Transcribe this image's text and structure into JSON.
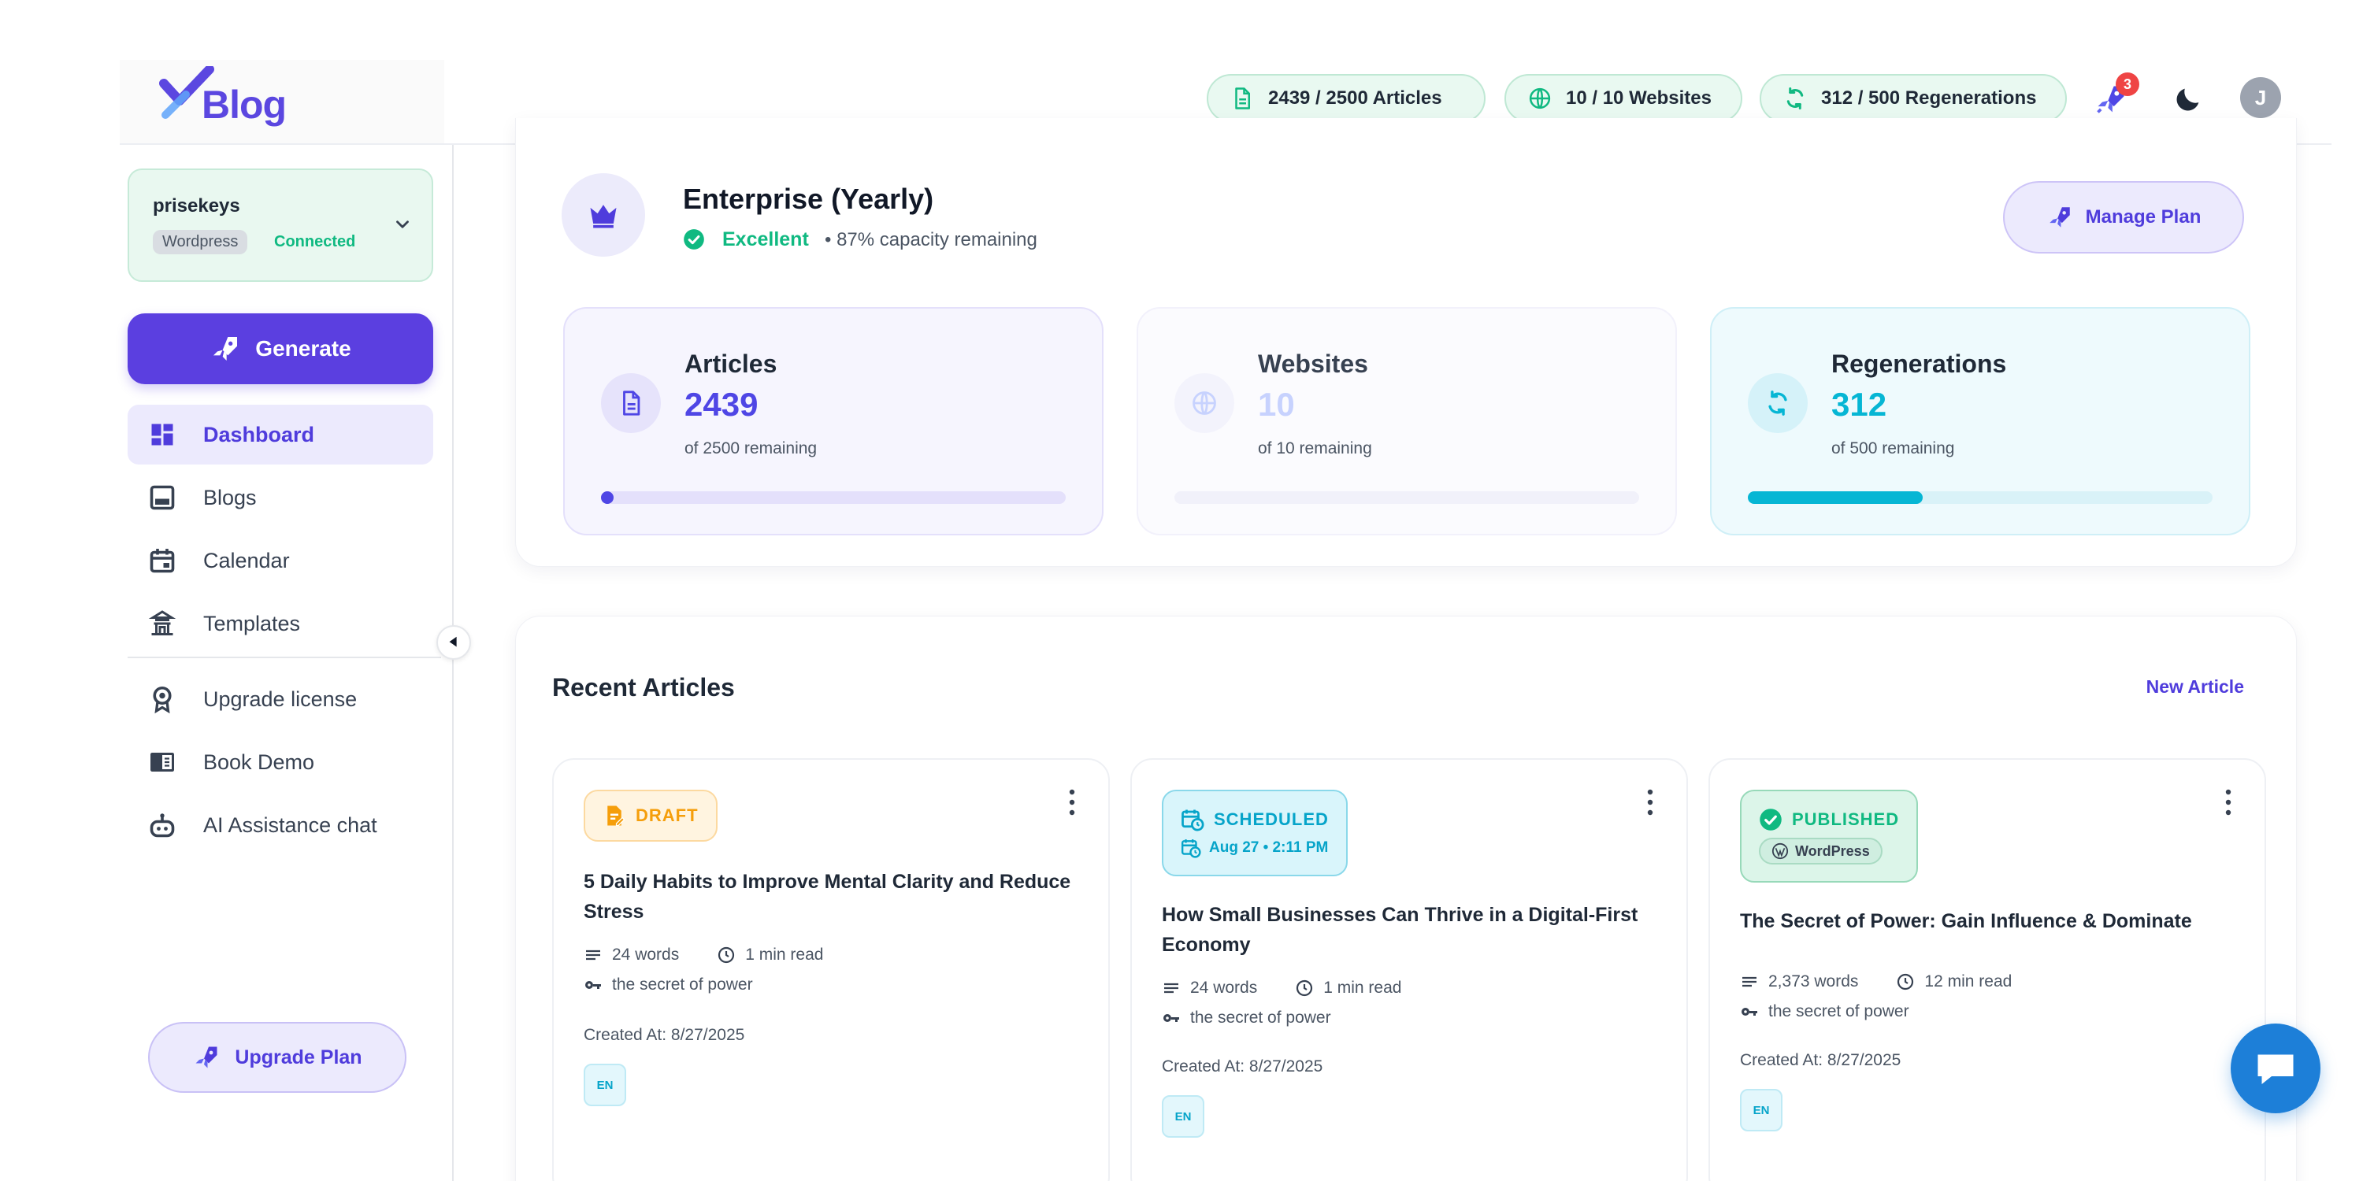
{
  "app": {
    "logo_text": "Blog"
  },
  "topbar": {
    "articles_quota": "2439 / 2500 Articles",
    "websites_quota": "10 / 10 Websites",
    "regen_quota": "312 / 500 Regenerations",
    "notification_count": "3",
    "avatar_initial": "J"
  },
  "sidebar": {
    "site": {
      "name": "prisekeys",
      "platform": "Wordpress",
      "status": "Connected"
    },
    "generate_label": "Generate",
    "items": [
      {
        "label": "Dashboard",
        "icon": "dashboard-icon",
        "active": true
      },
      {
        "label": "Blogs",
        "icon": "blogs-icon"
      },
      {
        "label": "Calendar",
        "icon": "calendar-icon"
      },
      {
        "label": "Templates",
        "icon": "templates-icon"
      },
      {
        "label": "Upgrade license",
        "icon": "award-icon"
      },
      {
        "label": "Book Demo",
        "icon": "book-icon"
      },
      {
        "label": "AI Assistance chat",
        "icon": "robot-icon"
      }
    ],
    "upgrade_label": "Upgrade Plan"
  },
  "plan": {
    "title": "Enterprise (Yearly)",
    "health": "Excellent",
    "capacity": "• 87% capacity remaining",
    "manage_label": "Manage Plan",
    "stats": [
      {
        "label": "Articles",
        "value": "2439",
        "sub": "of 2500 remaining",
        "fill": 0.024,
        "color": "#4f46e5"
      },
      {
        "label": "Websites",
        "value": "10",
        "sub": "of 10 remaining",
        "fill": 0.0,
        "color": "#c7d2fe"
      },
      {
        "label": "Regenerations",
        "value": "312",
        "sub": "of 500 remaining",
        "fill": 0.376,
        "color": "#06b6d4"
      }
    ]
  },
  "recent": {
    "title": "Recent Articles",
    "new_label": "New Article",
    "articles": [
      {
        "status": "DRAFT",
        "title": "5 Daily Habits to Improve Mental Clarity and Reduce Stress",
        "words": "24 words",
        "read": "1 min read",
        "keyword": "the secret of power",
        "created": "Created At: 8/27/2025",
        "lang": "EN"
      },
      {
        "status": "SCHEDULED",
        "schedule": "Aug 27 • 2:11 PM",
        "title": "How Small Businesses Can Thrive in a Digital-First Economy",
        "words": "24 words",
        "read": "1 min read",
        "keyword": "the secret of power",
        "created": "Created At: 8/27/2025",
        "lang": "EN"
      },
      {
        "status": "PUBLISHED",
        "platform": "WordPress",
        "title": "The Secret of Power: Gain Influence & Dominate",
        "words": "2,373 words",
        "read": "12 min read",
        "keyword": "the secret of power",
        "created": "Created At: 8/27/2025",
        "lang": "EN"
      }
    ]
  },
  "colors": {
    "primary": "#5b3fe0",
    "success": "#10b981",
    "draft": "#f59e0b",
    "scheduled": "#06a4c9",
    "accent_cyan": "#06b6d4"
  }
}
